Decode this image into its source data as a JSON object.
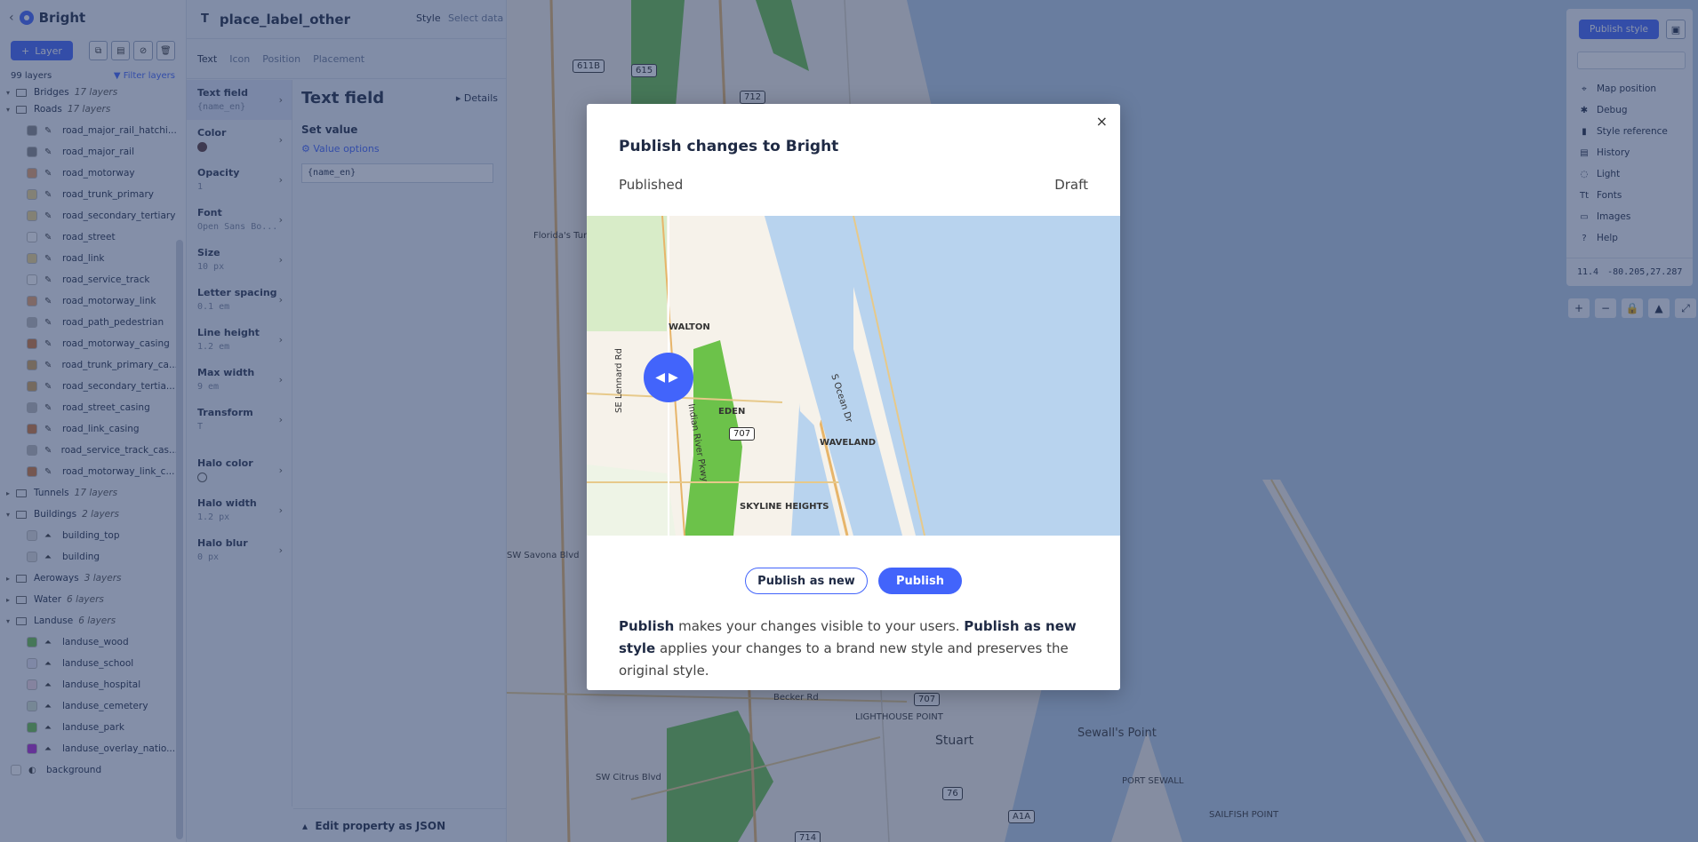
{
  "layers_panel": {
    "title": "Bright",
    "add_layer_label": "Layer",
    "layer_count": "99 layers",
    "filter_label": "Filter layers",
    "groups": [
      {
        "name": "Bridges",
        "count": "17 layers",
        "expanded": true,
        "children": []
      },
      {
        "name": "Roads",
        "count": "17 layers",
        "expanded": true,
        "children": [
          {
            "name": "road_major_rail_hatchi...",
            "color": "#888888"
          },
          {
            "name": "road_major_rail",
            "color": "#888888"
          },
          {
            "name": "road_motorway",
            "color": "#e8a36a"
          },
          {
            "name": "road_trunk_primary",
            "color": "#f1d88a"
          },
          {
            "name": "road_secondary_tertiary",
            "color": "#f1d88a"
          },
          {
            "name": "road_street",
            "color": "#ffffff"
          },
          {
            "name": "road_link",
            "color": "#f1d88a"
          },
          {
            "name": "road_service_track",
            "color": "#ffffff"
          },
          {
            "name": "road_motorway_link",
            "color": "#e8a36a"
          },
          {
            "name": "road_path_pedestrian",
            "color": "#bbbbbb"
          },
          {
            "name": "road_motorway_casing",
            "color": "#d27a3a"
          },
          {
            "name": "road_trunk_primary_ca...",
            "color": "#d2a45a"
          },
          {
            "name": "road_secondary_tertia...",
            "color": "#d2a45a"
          },
          {
            "name": "road_street_casing",
            "color": "#bbbbbb"
          },
          {
            "name": "road_link_casing",
            "color": "#d27a3a"
          },
          {
            "name": "road_service_track_cas...",
            "color": "#bbbbbb"
          },
          {
            "name": "road_motorway_link_c...",
            "color": "#d27a3a"
          }
        ]
      },
      {
        "name": "Tunnels",
        "count": "17 layers",
        "expanded": false,
        "children": []
      },
      {
        "name": "Buildings",
        "count": "2 layers",
        "expanded": true,
        "children": [
          {
            "name": "building_top",
            "color": "#dddddd"
          },
          {
            "name": "building",
            "color": "#dddddd"
          }
        ]
      },
      {
        "name": "Aeroways",
        "count": "3 layers",
        "expanded": false,
        "children": []
      },
      {
        "name": "Water",
        "count": "6 layers",
        "expanded": false,
        "children": []
      },
      {
        "name": "Landuse",
        "count": "6 layers",
        "expanded": true,
        "children": [
          {
            "name": "landuse_wood",
            "color": "#6cc24a"
          },
          {
            "name": "landuse_school",
            "color": "#e9e6f6"
          },
          {
            "name": "landuse_hospital",
            "color": "#f6dbe6"
          },
          {
            "name": "landuse_cemetery",
            "color": "#d4e4d0"
          },
          {
            "name": "landuse_park",
            "color": "#6cc24a"
          },
          {
            "name": "landuse_overlay_natio...",
            "color": "#b02ad6"
          }
        ]
      }
    ],
    "background_layer": "background"
  },
  "props_panel": {
    "layer_name": "place_label_other",
    "style_tab": "Style",
    "select_data_tab": "Select data",
    "tabs": [
      "Text",
      "Icon",
      "Position",
      "Placement"
    ],
    "properties": [
      {
        "label": "Text field",
        "value": "{name_en}"
      },
      {
        "label": "Color",
        "value": ""
      },
      {
        "label": "Opacity",
        "value": "1"
      },
      {
        "label": "Font",
        "value": "Open Sans Bo..."
      },
      {
        "label": "Size",
        "value": "10 px"
      },
      {
        "label": "Letter spacing",
        "value": "0.1 em"
      },
      {
        "label": "Line height",
        "value": "1.2 em"
      },
      {
        "label": "Max width",
        "value": "9 em"
      },
      {
        "label": "Transform",
        "value": "T"
      },
      {
        "label": "Halo color",
        "value": ""
      },
      {
        "label": "Halo width",
        "value": "1.2 px"
      },
      {
        "label": "Halo blur",
        "value": "0 px"
      }
    ],
    "detail_title": "Text field",
    "details_label": "Details",
    "set_value_label": "Set value",
    "value_options_label": "Value options",
    "field_value": "{name_en}",
    "json_edit_label": "Edit property as JSON"
  },
  "right_panel": {
    "publish_style_label": "Publish style",
    "menu": [
      {
        "label": "Map position",
        "icon": "crosshair-icon"
      },
      {
        "label": "Debug",
        "icon": "bug-icon"
      },
      {
        "label": "Style reference",
        "icon": "book-icon"
      },
      {
        "label": "History",
        "icon": "history-icon"
      },
      {
        "label": "Light",
        "icon": "bulb-icon"
      },
      {
        "label": "Fonts",
        "icon": "font-icon"
      },
      {
        "label": "Images",
        "icon": "image-icon"
      },
      {
        "label": "Help",
        "icon": "help-icon"
      }
    ],
    "zoom": "11.4",
    "coords": "-80.205,27.287"
  },
  "map": {
    "labels": [
      "611B",
      "615",
      "712",
      "707",
      "76",
      "A1A",
      "714",
      "LIGHTHOUSE POINT",
      "Stuart",
      "Sewall's Point",
      "PORT SEWALL",
      "SAILFISH POINT",
      "Becker Rd",
      "SW Citrus Blvd",
      "Florida's Turnpike",
      "SW Savona Blvd"
    ]
  },
  "modal": {
    "title": "Publish changes to Bright",
    "left_label": "Published",
    "right_label": "Draft",
    "preview_labels": [
      "WALTON",
      "EDEN",
      "707",
      "WAVELAND",
      "SKYLINE HEIGHTS",
      "SE Lennard Rd",
      "S Ocean Dr",
      "Indian River Pkwy"
    ],
    "publish_new_label": "Publish as new",
    "publish_label": "Publish",
    "desc_b1": "Publish",
    "desc_t1": " makes your changes visible to your users. ",
    "desc_b2": "Publish as new style",
    "desc_t2": " applies your changes to a brand new style and preserves the original style.",
    "close_label": "×"
  },
  "colors": {
    "accent": "#4264fb",
    "water": "#b8d3ee",
    "park": "#6cc24a"
  }
}
